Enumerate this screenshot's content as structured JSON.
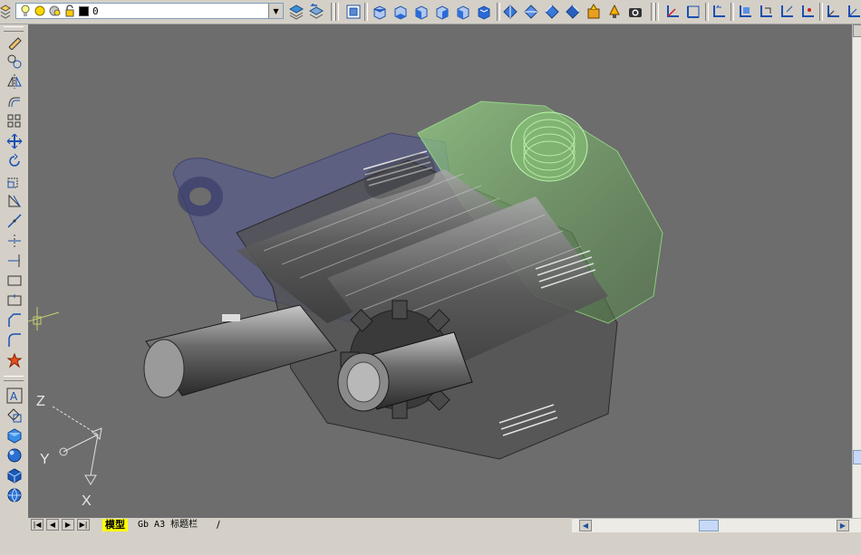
{
  "layer_toolbar": {
    "current_layer": "0",
    "dropdown_icon": "chevron-down-icon"
  },
  "layout_tabs": {
    "active": "模型",
    "second": "Gb A3 标题栏",
    "separator": "/"
  },
  "ucs_icon": {
    "x_label": "X",
    "y_label": "Y",
    "z_label": "Z"
  },
  "colors": {
    "viewport_bg": "#6d6d6d",
    "toolbar_bg": "#d4d0c8",
    "active_tab": "#ffff00",
    "green_housing": "#7fbf6a",
    "blue_cover": "#4a4f9a"
  }
}
